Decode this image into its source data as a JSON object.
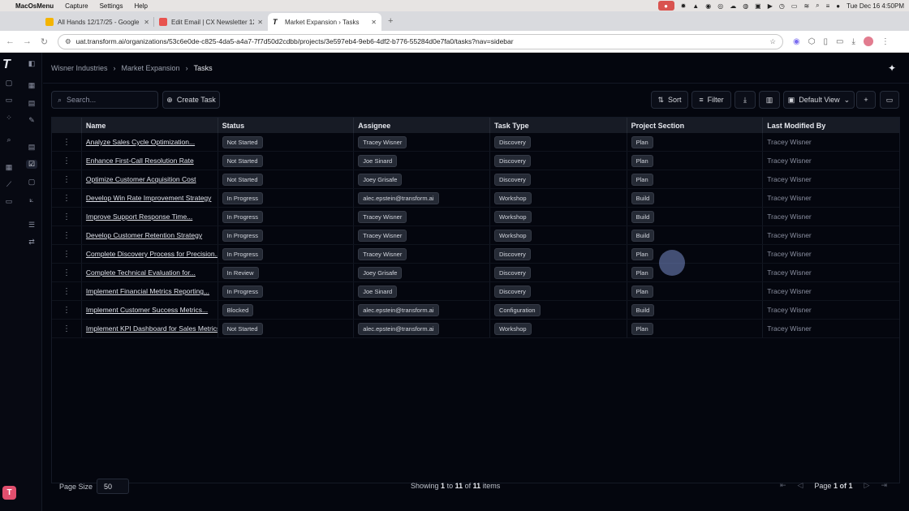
{
  "menubar": {
    "app": "MacOsMenu",
    "items": [
      "Capture",
      "Settings",
      "Help"
    ],
    "datetime": "Tue Dec 16  4:50PM"
  },
  "browser": {
    "tabs": [
      {
        "label": "All Hands 12/17/25 - Google",
        "icon_color": "#f4b400"
      },
      {
        "label": "Edit Email | CX Newsletter 12",
        "icon_color": "#e8534f"
      },
      {
        "label": "Market Expansion › Tasks",
        "icon_color": "#111111"
      }
    ],
    "url": "uat.transform.ai/organizations/53c6e0de-c825-4da5-a4a7-7f7d50d2cdbb/projects/3e597eb4-9eb6-4df2-b776-55284d0e7fa0/tasks?nav=sidebar"
  },
  "breadcrumb": [
    "Wisner Industries",
    "Market Expansion",
    "Tasks"
  ],
  "toolbar": {
    "search_placeholder": "Search...",
    "create_task": "Create Task",
    "sort": "Sort",
    "filter": "Filter",
    "view": "Default View"
  },
  "table": {
    "columns": [
      "Name",
      "Status",
      "Assignee",
      "Task Type",
      "Project Section",
      "Last Modified By"
    ],
    "rows": [
      {
        "name": "Analyze Sales Cycle Optimization...",
        "status": "Not Started",
        "assignee": "Tracey Wisner",
        "type": "Discovery",
        "section": "Plan",
        "modified": "Tracey Wisner"
      },
      {
        "name": "Enhance First-Call Resolution Rate",
        "status": "Not Started",
        "assignee": "Joe Sinard",
        "type": "Discovery",
        "section": "Plan",
        "modified": "Tracey Wisner"
      },
      {
        "name": "Optimize Customer Acquisition Cost",
        "status": "Not Started",
        "assignee": "Joey Grisafe",
        "type": "Discovery",
        "section": "Plan",
        "modified": "Tracey Wisner"
      },
      {
        "name": "Develop Win Rate Improvement Strategy",
        "status": "In Progress",
        "assignee": "alec.epstein@transform.ai",
        "type": "Workshop",
        "section": "Build",
        "modified": "Tracey Wisner"
      },
      {
        "name": "Improve Support Response Time...",
        "status": "In Progress",
        "assignee": "Tracey Wisner",
        "type": "Workshop",
        "section": "Build",
        "modified": "Tracey Wisner"
      },
      {
        "name": "Develop Customer Retention Strategy",
        "status": "In Progress",
        "assignee": "Tracey Wisner",
        "type": "Workshop",
        "section": "Build",
        "modified": "Tracey Wisner"
      },
      {
        "name": "Complete Discovery Process for Precision...",
        "status": "In Progress",
        "assignee": "Tracey Wisner",
        "type": "Discovery",
        "section": "Plan",
        "modified": "Tracey Wisner"
      },
      {
        "name": "Complete Technical Evaluation for...",
        "status": "In Review",
        "assignee": "Joey Grisafe",
        "type": "Discovery",
        "section": "Plan",
        "modified": "Tracey Wisner"
      },
      {
        "name": "Implement Financial Metrics Reporting...",
        "status": "In Progress",
        "assignee": "Joe Sinard",
        "type": "Discovery",
        "section": "Plan",
        "modified": "Tracey Wisner"
      },
      {
        "name": "Implement Customer Success Metrics...",
        "status": "Blocked",
        "assignee": "alec.epstein@transform.ai",
        "type": "Configuration",
        "section": "Build",
        "modified": "Tracey Wisner"
      },
      {
        "name": "Implement KPI Dashboard for Sales Metrics",
        "status": "Not Started",
        "assignee": "alec.epstein@transform.ai",
        "type": "Workshop",
        "section": "Plan",
        "modified": "Tracey Wisner"
      }
    ]
  },
  "footer": {
    "page_size_label": "Page Size",
    "page_size": "50",
    "showing_prefix": "Showing",
    "from": "1",
    "to_word": "to",
    "to": "11",
    "of_word": "of",
    "total": "11",
    "items_word": "items",
    "page_word": "Page",
    "page": "1",
    "page_of": "of",
    "pages": "1"
  },
  "rail": {
    "avatar_letter": "T"
  }
}
